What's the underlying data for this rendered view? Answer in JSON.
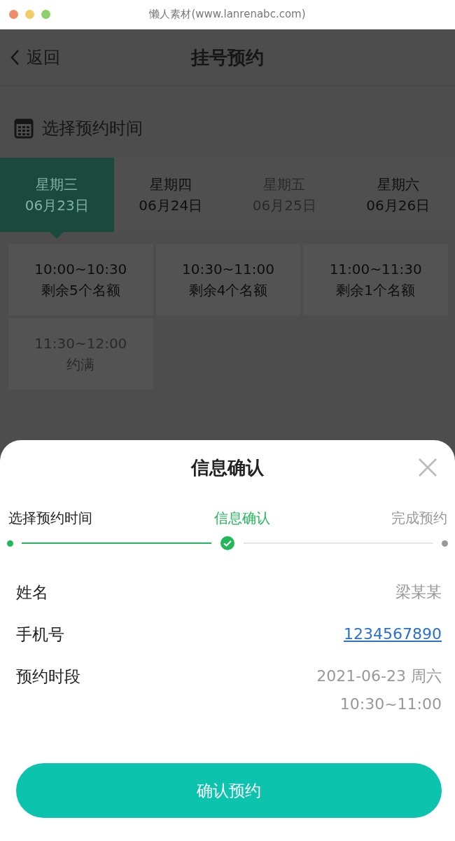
{
  "window": {
    "title": "懒人素材(www.lanrenabc.com)"
  },
  "nav": {
    "back": "返回",
    "title": "挂号预约"
  },
  "section_title": "选择预约时间",
  "days": [
    {
      "weekday": "星期三",
      "date": "06月23日",
      "selected": true,
      "disabled": false
    },
    {
      "weekday": "星期四",
      "date": "06月24日",
      "selected": false,
      "disabled": false
    },
    {
      "weekday": "星期五",
      "date": "06月25日",
      "selected": false,
      "disabled": true
    },
    {
      "weekday": "星期六",
      "date": "06月26日",
      "selected": false,
      "disabled": false
    }
  ],
  "slots": [
    {
      "time": "10:00~10:30",
      "status": "剩余5个名额",
      "disabled": false
    },
    {
      "time": "10:30~11:00",
      "status": "剩余4个名额",
      "disabled": false
    },
    {
      "time": "11:00~11:30",
      "status": "剩余1个名额",
      "disabled": false
    },
    {
      "time": "11:30~12:00",
      "status": "约满",
      "disabled": true
    }
  ],
  "dialog": {
    "title": "信息确认",
    "steps": [
      {
        "label": "选择预约时间",
        "done": true,
        "selected": false
      },
      {
        "label": "信息确认",
        "done": true,
        "selected": true
      },
      {
        "label": "完成预约",
        "done": false,
        "selected": false
      }
    ],
    "fields": [
      {
        "label": "姓名",
        "kind": "text",
        "lines": [
          "梁某某"
        ]
      },
      {
        "label": "手机号",
        "kind": "link",
        "lines": [
          "1234567890"
        ]
      },
      {
        "label": "预约时段",
        "kind": "text",
        "lines": [
          "2021-06-23 周六",
          "10:30~11:00"
        ]
      }
    ],
    "confirm": "确认预约"
  }
}
